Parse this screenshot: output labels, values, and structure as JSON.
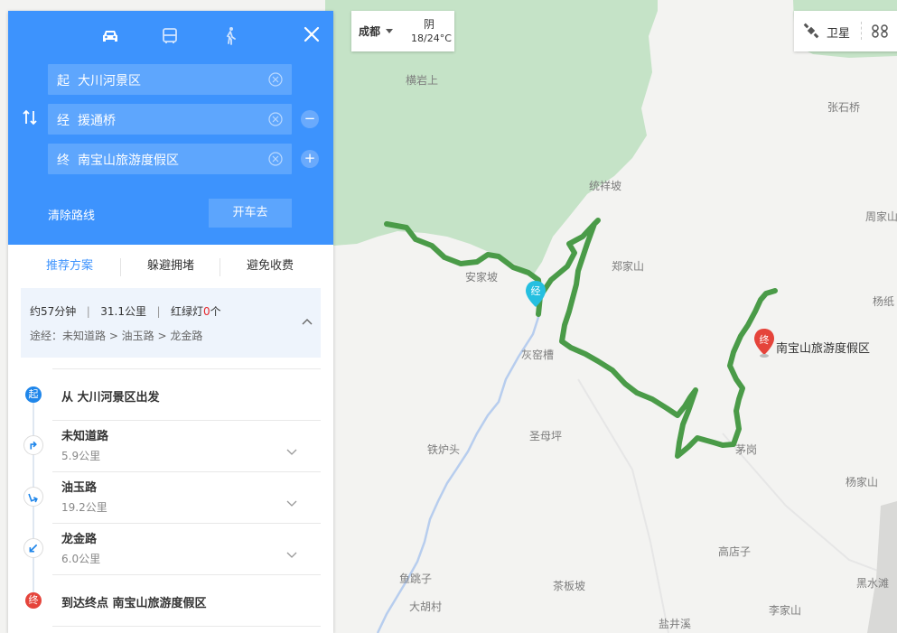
{
  "modes": [
    "car-icon",
    "bus-icon",
    "walk-icon"
  ],
  "route": {
    "start": {
      "tag": "起",
      "value": "大川河景区"
    },
    "via": {
      "tag": "经",
      "value": "援通桥"
    },
    "end": {
      "tag": "终",
      "value": "南宝山旅游度假区"
    }
  },
  "actions": {
    "clear": "清除路线",
    "drive": "开车去"
  },
  "tabs": [
    "推荐方案",
    "躲避拥堵",
    "避免收费"
  ],
  "summary": {
    "time": "约57分钟",
    "distance": "31.1公里",
    "lights_label": "红绿灯",
    "lights_count": "0",
    "lights_unit": "个",
    "via_roads": "途经：未知道路 > 油玉路 > 龙金路"
  },
  "steps": {
    "start": {
      "badge": "起",
      "title": "从 大川河景区出发"
    },
    "items": [
      {
        "title": "未知道路",
        "distance": "5.9公里"
      },
      {
        "title": "油玉路",
        "distance": "19.2公里"
      },
      {
        "title": "龙金路",
        "distance": "6.0公里"
      }
    ],
    "end": {
      "badge": "终",
      "title": "到达终点 南宝山旅游度假区"
    }
  },
  "weather": {
    "city": "成都",
    "condition": "阴",
    "temp": "18/24°C"
  },
  "layers": {
    "satellite": "卫星"
  },
  "map": {
    "labels": [
      "横岩上",
      "张石桥",
      "统祥坡",
      "周家山",
      "郑家山",
      "杨纸",
      "安家坡",
      "灰窑槽",
      "圣母坪",
      "铁炉头",
      "茅岗",
      "杨家山",
      "高店子",
      "鱼跳子",
      "茶板坡",
      "大胡村",
      "黑水滩",
      "李家山",
      "盐井溪"
    ],
    "via_marker": "经",
    "end_marker": "终",
    "end_label": "南宝山旅游度假区"
  },
  "colors": {
    "accent": "#3d93fd",
    "route": "#4a9b48",
    "end": "#e5443b",
    "via": "#25bfe0"
  }
}
